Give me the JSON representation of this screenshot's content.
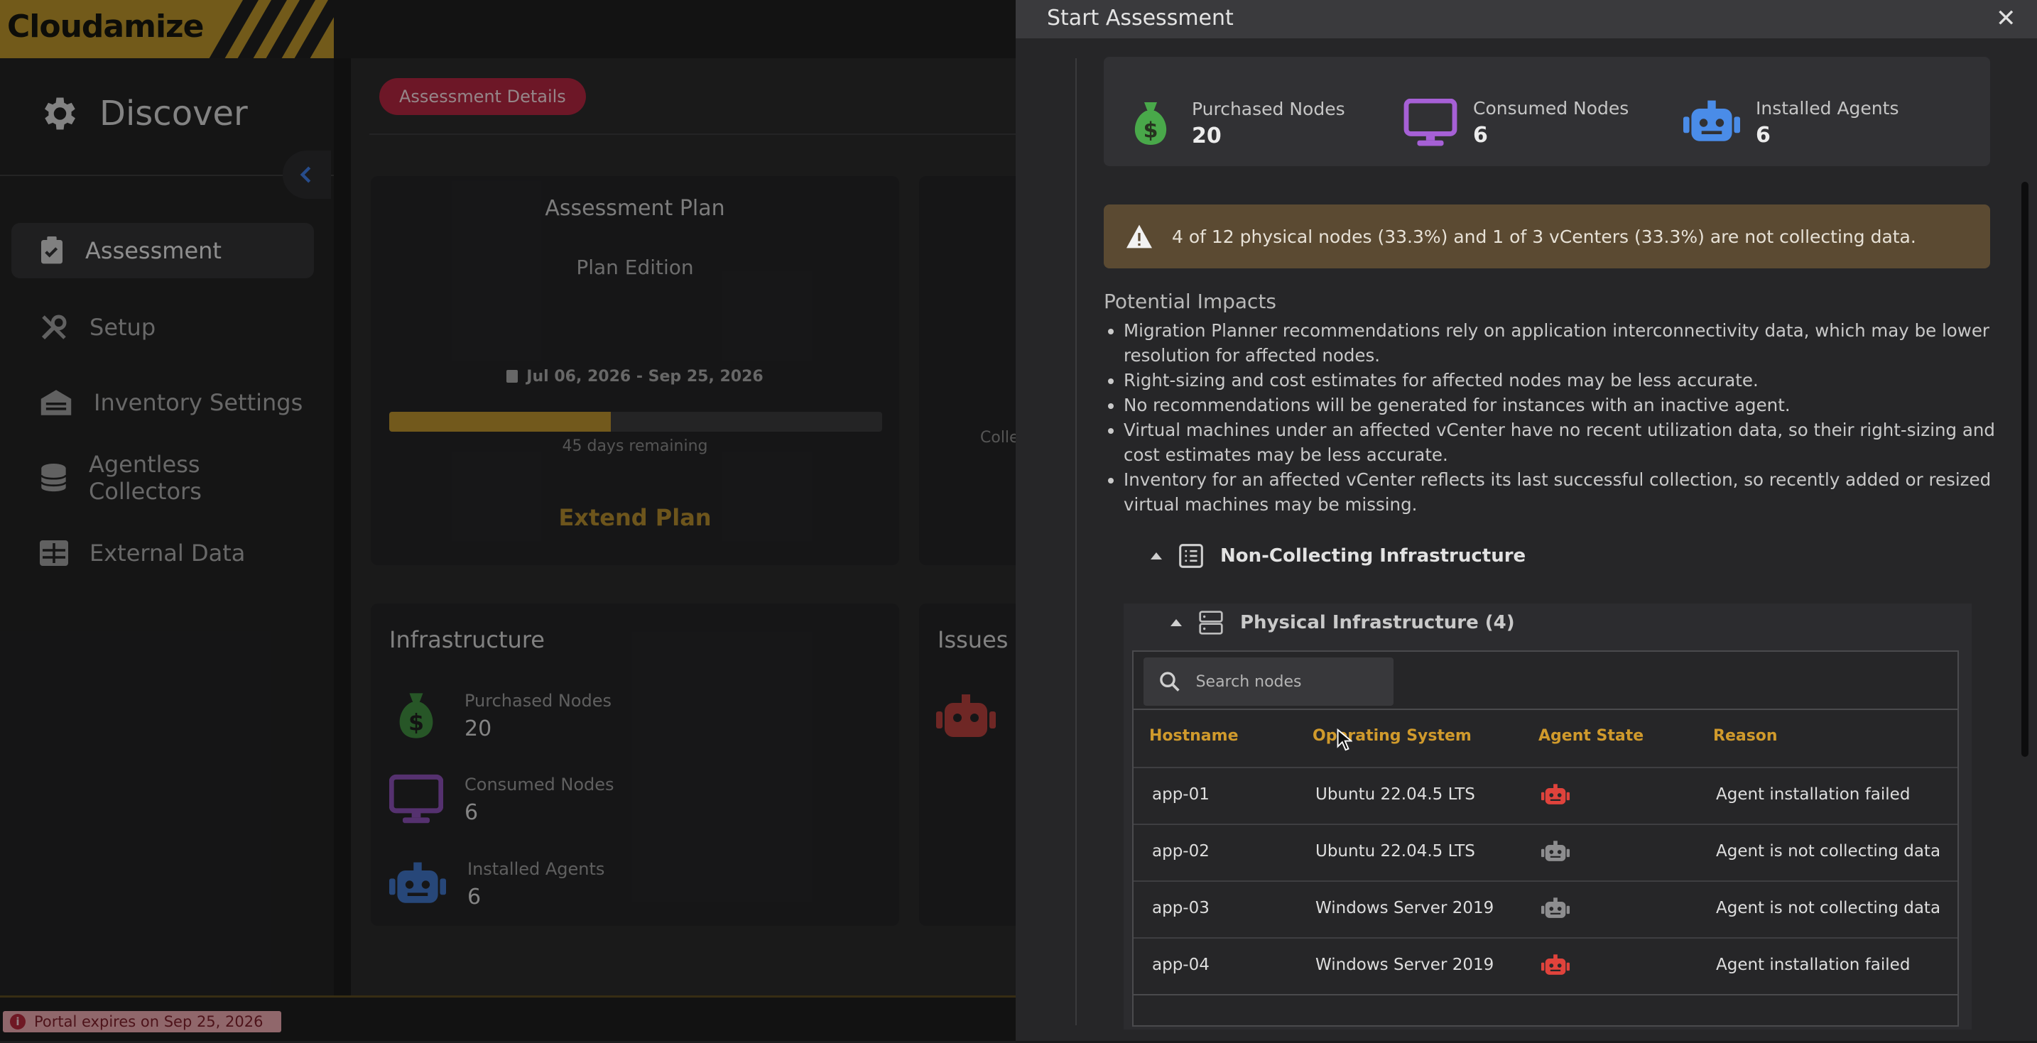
{
  "app": {
    "logo": "Cloudamize",
    "section": "Discover"
  },
  "sidebar": {
    "items": [
      {
        "label": "Assessment",
        "icon": "clipboard-check-icon"
      },
      {
        "label": "Setup",
        "icon": "tools-icon"
      },
      {
        "label": "Inventory Settings",
        "icon": "warehouse-icon"
      },
      {
        "label": "Agentless Collectors",
        "icon": "database-icon"
      },
      {
        "label": "External Data",
        "icon": "table-icon"
      }
    ]
  },
  "main": {
    "pill": "Assessment Details",
    "plan": {
      "title": "Assessment Plan",
      "edition": "Plan Edition",
      "dates": "Jul 06, 2026 - Sep 25, 2026",
      "progress": 0.45,
      "remaining": "45 days remaining",
      "extend": "Extend Plan"
    },
    "collect_stub": "Colle",
    "infrastructure": {
      "title": "Infrastructure",
      "stats": [
        {
          "label": "Purchased Nodes",
          "value": "20"
        },
        {
          "label": "Consumed Nodes",
          "value": "6"
        },
        {
          "label": "Installed Agents",
          "value": "6"
        }
      ]
    },
    "issues_title": "Issues"
  },
  "footer": {
    "expires": "Portal expires on Sep 25, 2026"
  },
  "modal": {
    "title": "Start Assessment",
    "close": "✕",
    "stats": [
      {
        "label": "Purchased Nodes",
        "value": "20"
      },
      {
        "label": "Consumed Nodes",
        "value": "6"
      },
      {
        "label": "Installed Agents",
        "value": "6"
      }
    ],
    "warning": "4 of 12 physical nodes (33.3%) and 1 of 3 vCenters (33.3%) are not collecting data.",
    "impacts_title": "Potential Impacts",
    "impacts": [
      "Migration Planner recommendations rely on application interconnectivity data, which may be lower resolution for affected nodes.",
      "Right-sizing and cost estimates for affected nodes may be less accurate.",
      "No recommendations will be generated for instances with an inactive agent.",
      "Virtual machines under an affected vCenter have no recent utilization data, so their right-sizing and cost estimates may be less accurate.",
      "Inventory for an affected vCenter reflects its last successful collection, so recently added or resized virtual machines may be missing."
    ],
    "non_collecting": "Non-Collecting Infrastructure",
    "physical": "Physical Infrastructure (4)",
    "search_placeholder": "Search nodes",
    "columns": [
      "Hostname",
      "Operating System",
      "Agent State",
      "Reason"
    ],
    "rows": [
      {
        "host": "app-01",
        "os": "Ubuntu 22.04.5 LTS",
        "state": "failed",
        "reason": "Agent installation failed"
      },
      {
        "host": "app-02",
        "os": "Ubuntu 22.04.5 LTS",
        "state": "inactive",
        "reason": "Agent is not collecting data"
      },
      {
        "host": "app-03",
        "os": "Windows Server 2019",
        "state": "inactive",
        "reason": "Agent is not collecting data"
      },
      {
        "host": "app-04",
        "os": "Windows Server 2019",
        "state": "failed",
        "reason": "Agent installation failed"
      }
    ]
  },
  "colors": {
    "brand_gold": "#b8912a",
    "accent_red": "#b0263f",
    "column_header": "#d09a2c",
    "agent_failed": "#e0433c",
    "agent_inactive": "#8d8d8f",
    "money_green": "#49a84a",
    "monitor_purple": "#a660d6",
    "robot_blue": "#4a8ce8"
  }
}
